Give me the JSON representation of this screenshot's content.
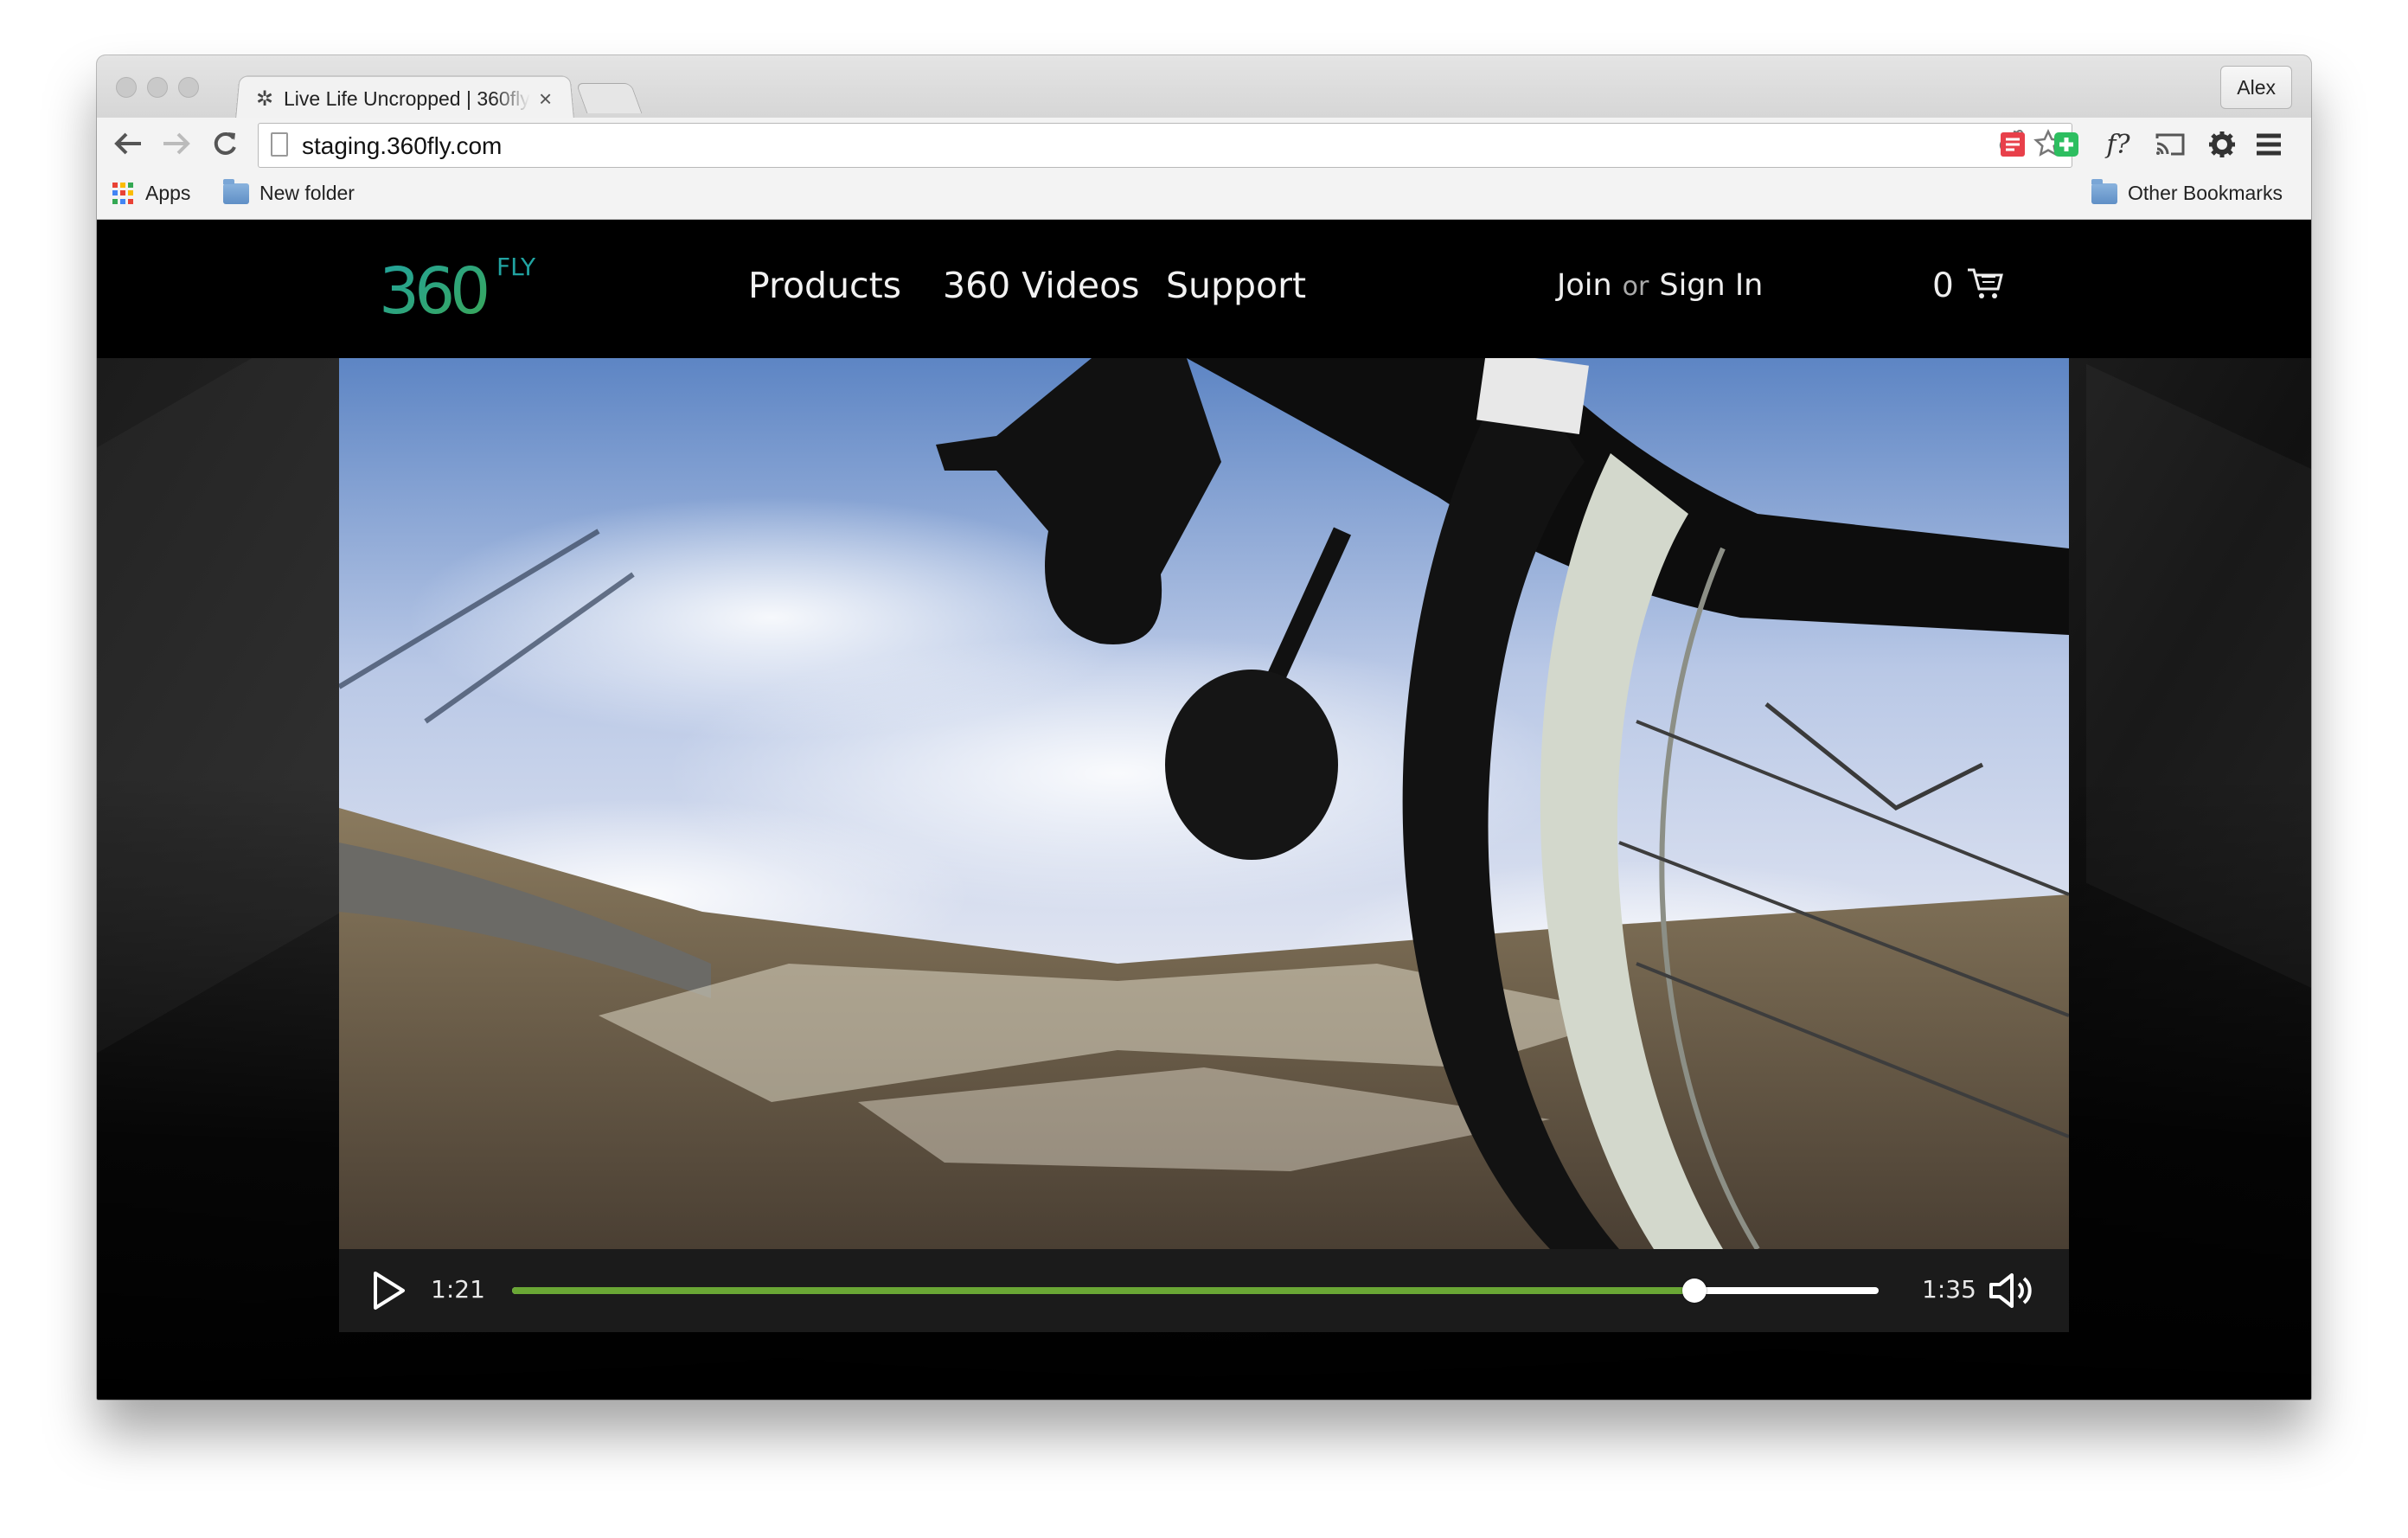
{
  "browser": {
    "tab_title": "Live Life Uncropped | 360fly",
    "tab_close": "×",
    "profile_name": "Alex",
    "url": "staging.360fly.com",
    "bookmarks": {
      "apps_label": "Apps",
      "folder_label": "New folder",
      "other_label": "Other Bookmarks"
    },
    "extensions": [
      "reddit-icon",
      "bookmark-star-icon",
      "pocket-icon",
      "evernote-icon",
      "font-f-icon",
      "cast-icon",
      "gear-icon",
      "menu-icon"
    ]
  },
  "site": {
    "logo_number": "360",
    "logo_word": "FLY",
    "nav": [
      "Products",
      "360 Videos",
      "Support"
    ],
    "join": "Join",
    "or": "or",
    "sign_in": "Sign In",
    "cart_count": "0"
  },
  "player": {
    "current_time": "1:21",
    "duration": "1:35",
    "progress": 0.865
  },
  "colors": {
    "accent_green": "#6aa735",
    "logo_teal": "#21a3a1",
    "logo_green": "#3aa655"
  }
}
